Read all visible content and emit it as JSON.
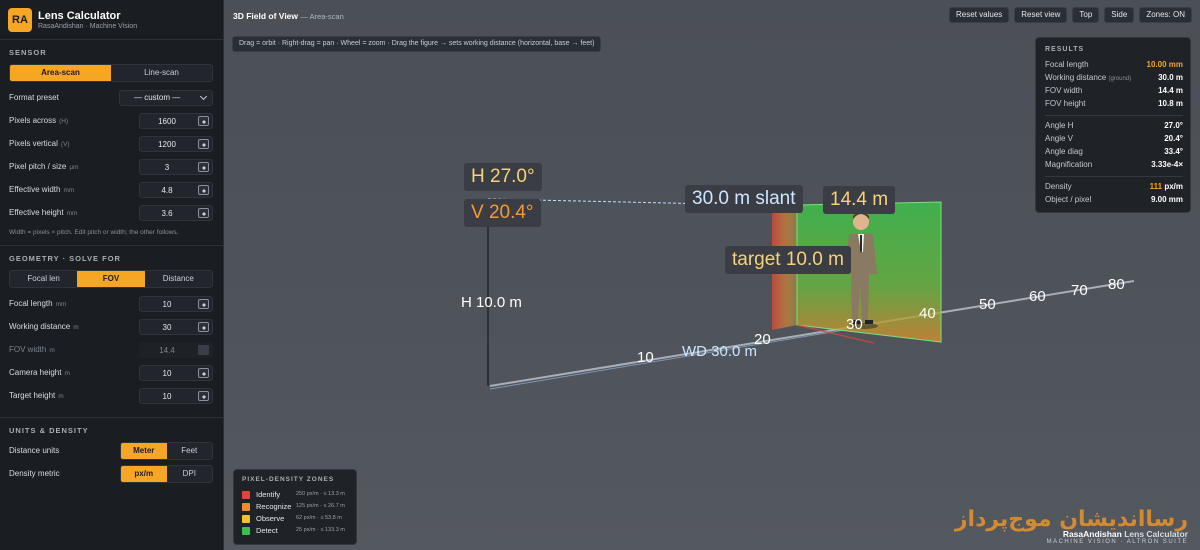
{
  "brand": {
    "logo": "RA",
    "title": "Lens Calculator",
    "subtitle": "RasaAndishan · Machine Vision"
  },
  "sensor": {
    "section": "SENSOR",
    "modes": [
      "Area-scan",
      "Line-scan"
    ],
    "format": {
      "label": "Format preset",
      "value": "— custom —"
    },
    "fields": [
      {
        "label": "Pixels across",
        "unit": "(H)",
        "value": "1600"
      },
      {
        "label": "Pixels vertical",
        "unit": "(V)",
        "value": "1200"
      },
      {
        "label": "Pixel pitch / size",
        "unit": "µm",
        "value": "3"
      },
      {
        "label": "Effective width",
        "unit": "mm",
        "value": "4.8"
      },
      {
        "label": "Effective height",
        "unit": "mm",
        "value": "3.6"
      }
    ],
    "note": "Width = pixels × pitch. Edit pitch or width; the other follows."
  },
  "geometry": {
    "section": "GEOMETRY · SOLVE FOR",
    "modes": [
      "Focal len",
      "FOV",
      "Distance"
    ],
    "fields": [
      {
        "label": "Focal length",
        "unit": "mm",
        "value": "10"
      },
      {
        "label": "Working distance",
        "unit": "m",
        "value": "30"
      },
      {
        "label": "FOV width",
        "unit": "m",
        "value": "14.4"
      },
      {
        "label": "Camera height",
        "unit": "m",
        "value": "10"
      },
      {
        "label": "Target height",
        "unit": "m",
        "value": "10"
      }
    ]
  },
  "units": {
    "section": "UNITS & DENSITY",
    "distance": {
      "label": "Distance units",
      "options": [
        "Meter",
        "Feet"
      ]
    },
    "density": {
      "label": "Density metric",
      "options": [
        "px/m",
        "DPI"
      ]
    }
  },
  "view": {
    "title": "3D Field of View",
    "subtitle": "— Area-scan",
    "toolbar": [
      "Reset values",
      "Reset view",
      "Top",
      "Side",
      "Zones: ON"
    ],
    "hint": "Drag = orbit · Right-drag = pan · Wheel = zoom · Drag the figure → sets working distance (horizontal, base → feet)",
    "labels": {
      "h_angle": "H 27.0°",
      "v_angle": "V 20.4°",
      "slant": "30.0 m slant",
      "fov_w": "14.4 m",
      "target": "target 10.0 m",
      "cam_h": "H 10.0 m",
      "wd": "WD 30.0 m"
    },
    "ticks": [
      "10",
      "20",
      "30",
      "40",
      "50",
      "60",
      "70",
      "80"
    ]
  },
  "results": {
    "title": "RESULTS",
    "rows": [
      {
        "k": "Focal length",
        "v": "10.00 mm",
        "acc": true
      },
      {
        "k": "Working distance",
        "note": "(ground)",
        "v": "30.0 m"
      },
      {
        "k": "FOV width",
        "v": "14.4 m"
      },
      {
        "k": "FOV height",
        "v": "10.8 m"
      },
      {
        "k": "Angle H",
        "v": "27.0°"
      },
      {
        "k": "Angle V",
        "v": "20.4°"
      },
      {
        "k": "Angle diag",
        "v": "33.4°"
      },
      {
        "k": "Magnification",
        "v": "3.33e-4×"
      },
      {
        "k": "Density",
        "v": "111",
        "unit": "px/m",
        "acc": true
      },
      {
        "k": "Object / pixel",
        "v": "9.00 mm"
      }
    ]
  },
  "zones": {
    "title": "PIXEL-DENSITY ZONES",
    "items": [
      {
        "name": "Identify",
        "detail": "250 px/m · ≤ 13.3 m",
        "color": "#e0443a"
      },
      {
        "name": "Recognize",
        "detail": "125 px/m · ≤ 26.7 m",
        "color": "#f08a2e"
      },
      {
        "name": "Observe",
        "detail": "62 px/m · ≤ 53.8 m",
        "color": "#f2c12e"
      },
      {
        "name": "Detect",
        "detail": "25 px/m · ≤ 133.3 m",
        "color": "#3cc04a"
      }
    ]
  },
  "watermark": {
    "fa": "رسااندیشان موج‌پرداز",
    "en_a": "RasaAndishan",
    "en_b": " Lens Calculator",
    "sub": "MACHINE VISION · ALTRON SUITE"
  },
  "colors": {
    "accent": "#f5a623",
    "panel": "#1a1d22",
    "viewport": "#4f545b"
  }
}
